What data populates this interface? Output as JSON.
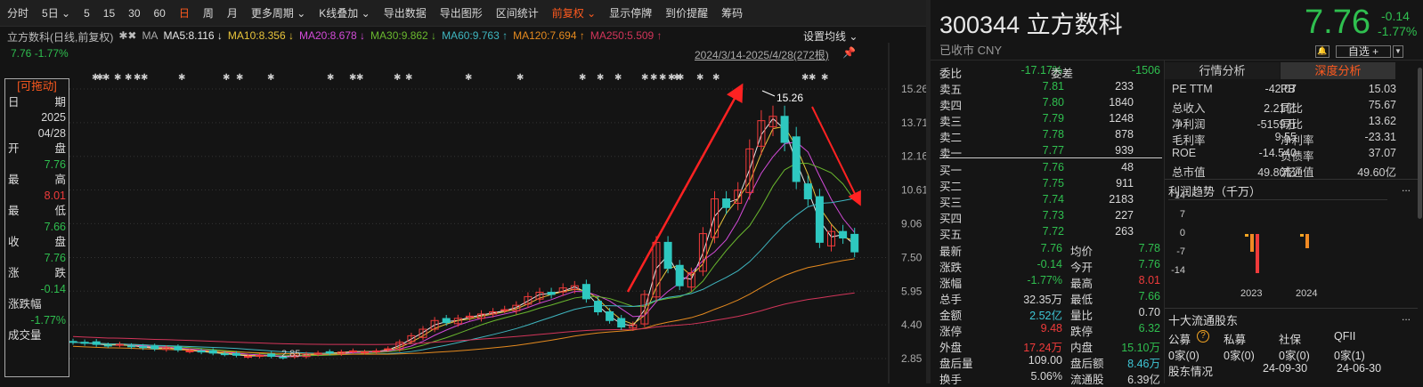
{
  "toolbar": {
    "items": [
      "分时",
      "5日 ⌄",
      "5",
      "15",
      "30",
      "60",
      "日",
      "周",
      "月",
      "更多周期 ⌄",
      "K线叠加 ⌄",
      "导出数据",
      "导出图形",
      "区间统计",
      "前复权 ⌄",
      "显示停牌",
      "到价提醒",
      "筹码"
    ],
    "active": [
      6,
      14
    ],
    "icons": [
      "chevron-circle-icon",
      "brush-icon",
      "fullscreen-icon"
    ]
  },
  "ma_bar": {
    "title": "立方数科(日线,前复权)",
    "ma_label": "MA",
    "items": [
      {
        "text": "MA5:8.116 ↓",
        "color": "#e8e8e8"
      },
      {
        "text": "MA10:8.356 ↓",
        "color": "#e8c43b"
      },
      {
        "text": "MA20:8.678 ↓",
        "color": "#d24bd8"
      },
      {
        "text": "MA30:9.862 ↓",
        "color": "#6ab82e"
      },
      {
        "text": "MA60:9.763 ↑",
        "color": "#3fb6c0"
      },
      {
        "text": "MA120:7.694 ↑",
        "color": "#e58a1f"
      },
      {
        "text": "MA250:5.509 ↑",
        "color": "#d2355a"
      }
    ],
    "quote": "7.76 -1.77%",
    "set_ma": "设置均线 ⌄",
    "range": "2024/3/14-2025/4/28(272根)"
  },
  "info_box": {
    "title": "[可拖动]",
    "rows": [
      [
        "日",
        "期"
      ],
      [
        "",
        "2025"
      ],
      [
        "",
        "04/28"
      ],
      [
        "开",
        "盘"
      ],
      [
        "",
        "7.76"
      ],
      [
        "最",
        "高"
      ],
      [
        "",
        "8.01"
      ],
      [
        "最",
        "低"
      ],
      [
        "",
        "7.66"
      ],
      [
        "收",
        "盘"
      ],
      [
        "",
        "7.76"
      ],
      [
        "涨",
        "跌"
      ],
      [
        "",
        "-0.14"
      ],
      [
        "涨跌幅",
        ""
      ],
      [
        "",
        "-1.77%"
      ],
      [
        "成交量",
        ""
      ]
    ]
  },
  "chart_data": {
    "type": "candlestick",
    "y_ticks": [
      "15.26",
      "13.71",
      "12.16",
      "10.61",
      "9.06",
      "7.50",
      "5.95",
      "4.40",
      "2.85"
    ],
    "ylim": [
      2.85,
      15.26
    ],
    "high_label": "15.26",
    "low_label": "2.85",
    "closes": [
      3.6,
      3.55,
      3.5,
      3.45,
      3.5,
      3.4,
      3.35,
      3.3,
      3.35,
      3.25,
      3.2,
      3.15,
      3.1,
      3.05,
      3.0,
      2.95,
      3.0,
      2.95,
      2.9,
      3.0,
      3.05,
      3.1,
      3.1,
      3.15,
      3.2,
      3.15,
      3.2,
      3.3,
      3.6,
      3.9,
      4.2,
      4.6,
      4.5,
      4.7,
      4.8,
      4.9,
      5.0,
      5.1,
      5.3,
      5.7,
      5.9,
      5.8,
      6.1,
      6.2,
      5.6,
      5.0,
      4.6,
      4.3,
      4.4,
      5.8,
      8.2,
      7.0,
      6.2,
      6.8,
      8.6,
      10.2,
      9.8,
      10.6,
      12.5,
      13.8,
      14.0,
      12.8,
      11.0,
      10.2,
      8.2,
      8.7,
      8.4,
      7.76
    ],
    "ma_colors": [
      "#e8e8e8",
      "#e8c43b",
      "#d24bd8",
      "#6ab82e",
      "#3fb6c0",
      "#e58a1f",
      "#d2355a"
    ]
  },
  "quote": {
    "code_name": "300344 立方数科",
    "status": "已收市 CNY",
    "price": "7.76",
    "change": "-0.14",
    "pct": "-1.77%",
    "watch": "自选 +"
  },
  "orderbook": {
    "ratio_label": "委比",
    "ratio": "-17.17%",
    "diff_label": "委差",
    "diff": "-1506",
    "asks": [
      [
        "卖五",
        "7.81",
        "233"
      ],
      [
        "卖四",
        "7.80",
        "1840"
      ],
      [
        "卖三",
        "7.79",
        "1248"
      ],
      [
        "卖二",
        "7.78",
        "878"
      ],
      [
        "卖一",
        "7.77",
        "939"
      ]
    ],
    "bids": [
      [
        "买一",
        "7.76",
        "48"
      ],
      [
        "买二",
        "7.75",
        "911"
      ],
      [
        "买三",
        "7.74",
        "2183"
      ],
      [
        "买四",
        "7.73",
        "227"
      ],
      [
        "买五",
        "7.72",
        "263"
      ]
    ],
    "stats": [
      [
        "最新",
        "7.76",
        "g",
        "均价",
        "7.78",
        "g"
      ],
      [
        "涨跌",
        "-0.14",
        "g",
        "今开",
        "7.76",
        "g"
      ],
      [
        "涨幅",
        "-1.77%",
        "g",
        "最高",
        "8.01",
        "rd"
      ],
      [
        "总手",
        "32.35万",
        "w",
        "最低",
        "7.66",
        "g"
      ],
      [
        "金额",
        "2.52亿",
        "cy",
        "量比",
        "0.70",
        "w"
      ],
      [
        "涨停",
        "9.48",
        "rd",
        "跌停",
        "6.32",
        "g"
      ],
      [
        "外盘",
        "17.24万",
        "rd",
        "内盘",
        "15.10万",
        "g"
      ],
      [
        "盘后量",
        "109.00",
        "w",
        "盘后额",
        "8.46万",
        "cy"
      ],
      [
        "换手",
        "5.06%",
        "w",
        "流通股",
        "6.39亿",
        "w"
      ]
    ]
  },
  "analysis": {
    "tabs": [
      "行情分析",
      "深度分析"
    ],
    "metrics": [
      [
        "PE TTM",
        "-42.07",
        "PB",
        "15.03"
      ],
      [
        "总收入",
        "2.21亿",
        "同比",
        "75.67"
      ],
      [
        "净利润",
        "-5159万",
        "同比",
        "13.62"
      ],
      [
        "毛利率",
        "9.55",
        "净利率",
        "-23.31"
      ],
      [
        "ROE",
        "-14.540",
        "负债率",
        "37.07"
      ],
      [
        "总市值",
        "49.80亿",
        "流通值",
        "49.60亿"
      ]
    ],
    "profit_title": "利润趋势（千万）",
    "profit_chart": {
      "type": "bar",
      "y_ticks": [
        "14",
        "7",
        "0",
        "-7",
        "-14"
      ],
      "ylim": [
        -14,
        14
      ],
      "groups": [
        {
          "year": "2023",
          "values": [
            -1,
            -6.5,
            -14.5
          ]
        },
        {
          "year": "2024",
          "values": [
            -1,
            -5.2
          ]
        }
      ]
    },
    "holders_title": "十大流通股东",
    "more": "...",
    "holder_types": [
      "公募",
      "私募",
      "社保",
      "QFII"
    ],
    "holder_counts": [
      "0家(0)",
      "0家(0)",
      "0家(0)",
      "0家(1)"
    ],
    "holder_info_label": "股东情况",
    "dates": [
      "24-09-30",
      "24-06-30"
    ]
  }
}
